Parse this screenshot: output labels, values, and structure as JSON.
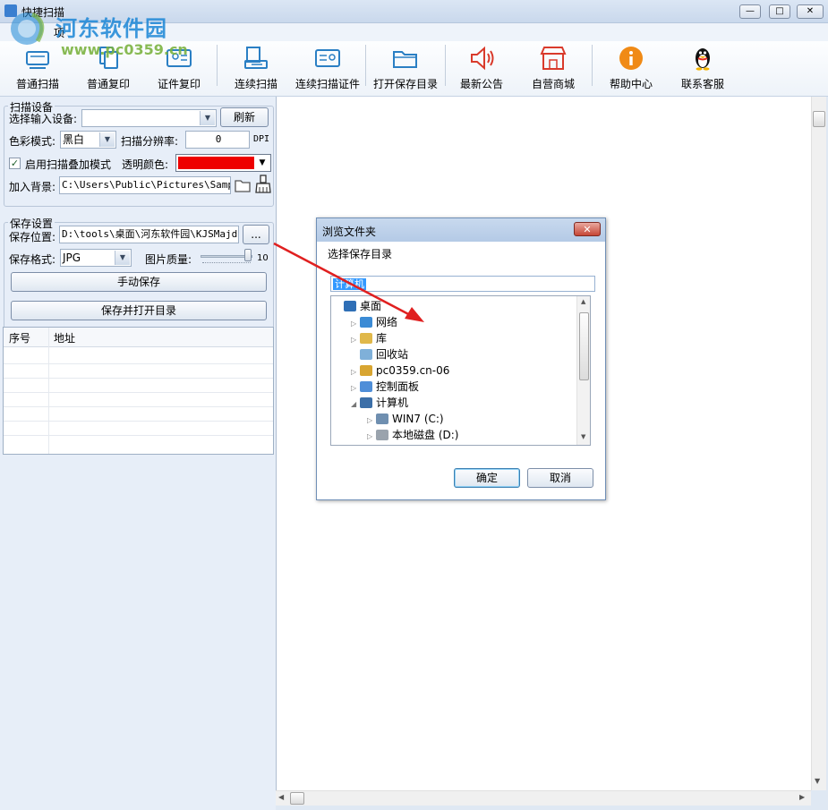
{
  "app": {
    "title": "快捷扫描",
    "menu_item": "项",
    "win_min": "—",
    "win_max": "□",
    "win_close": "✕"
  },
  "watermark": {
    "title": "河东软件园",
    "url": "www.pc0359.cn"
  },
  "toolbar": {
    "items": [
      {
        "label": "普通扫描",
        "icon": "scanner-icon"
      },
      {
        "label": "普通复印",
        "icon": "copy-icon"
      },
      {
        "label": "证件复印",
        "icon": "id-card-icon"
      },
      {
        "label": "连续扫描",
        "icon": "continuous-scan-icon"
      },
      {
        "label": "连续扫描证件",
        "icon": "continuous-id-scan-icon"
      },
      {
        "label": "打开保存目录",
        "icon": "folder-open-icon"
      },
      {
        "label": "最新公告",
        "icon": "speaker-icon"
      },
      {
        "label": "自营商城",
        "icon": "store-icon"
      },
      {
        "label": "帮助中心",
        "icon": "info-icon"
      },
      {
        "label": "联系客服",
        "icon": "qq-penguin-icon"
      }
    ]
  },
  "scan_settings": {
    "title": "扫描设备",
    "device_label": "选择输入设备:",
    "device_value": "",
    "refresh_label": "刷新",
    "color_mode_label": "色彩模式:",
    "color_mode_value": "黑白",
    "resolution_label": "扫描分辨率:",
    "resolution_value": "0",
    "resolution_unit": "DPI",
    "overlay_label": "启用扫描叠加模式",
    "overlay_checked": true,
    "transparent_label": "透明颜色:",
    "transparent_color": "#ee0000",
    "background_label": "加入背景:",
    "background_value": "C:\\Users\\Public\\Pictures\\Sample"
  },
  "save_settings": {
    "title": "保存设置",
    "location_label": "保存位置:",
    "location_value": "D:\\tools\\桌面\\河东软件园\\KJSMajdj",
    "browse_label": "...",
    "format_label": "保存格式:",
    "format_value": "JPG",
    "quality_label": "图片质量:",
    "quality_value": "10",
    "manual_save_label": "手动保存",
    "save_open_label": "保存并打开目录"
  },
  "file_table": {
    "col_index": "序号",
    "col_address": "地址"
  },
  "dialog": {
    "title": "浏览文件夹",
    "close": "✕",
    "prompt": "选择保存目录",
    "selected_path": "计算机",
    "tree": [
      {
        "label": "桌面",
        "icon": "desktop-icon",
        "indent": 0,
        "expander": ""
      },
      {
        "label": "网络",
        "icon": "network-icon",
        "indent": 1,
        "expander": "▷"
      },
      {
        "label": "库",
        "icon": "library-icon",
        "indent": 1,
        "expander": "▷"
      },
      {
        "label": "回收站",
        "icon": "recycle-bin-icon",
        "indent": 1,
        "expander": ""
      },
      {
        "label": "pc0359.cn-06",
        "icon": "user-folder-icon",
        "indent": 1,
        "expander": "▷"
      },
      {
        "label": "控制面板",
        "icon": "control-panel-icon",
        "indent": 1,
        "expander": "▷"
      },
      {
        "label": "计算机",
        "icon": "computer-icon",
        "indent": 1,
        "expander": "◢"
      },
      {
        "label": "WIN7 (C:)",
        "icon": "system-drive-icon",
        "indent": 2,
        "expander": "▷"
      },
      {
        "label": "本地磁盘 (D:)",
        "icon": "local-disk-icon",
        "indent": 2,
        "expander": "▷"
      }
    ],
    "ok_label": "确定",
    "cancel_label": "取消"
  },
  "colors": {
    "arrow": "#e02020",
    "selection": "#3399ff"
  }
}
